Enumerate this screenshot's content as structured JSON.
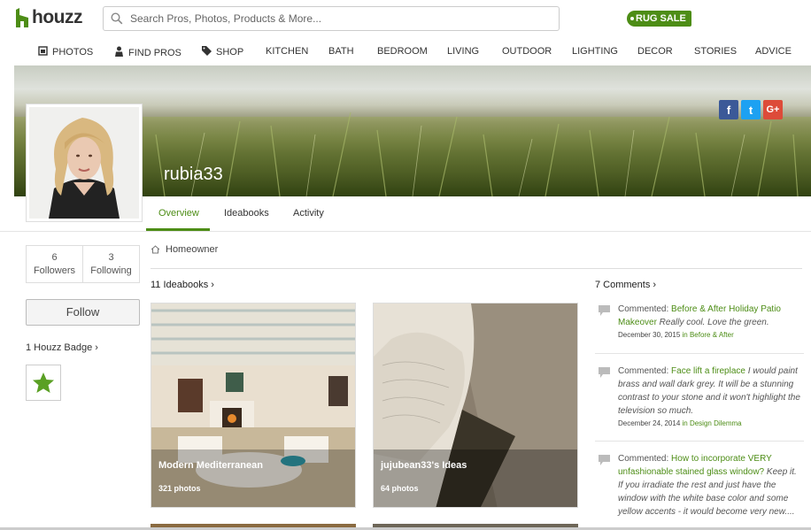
{
  "header": {
    "logo_text": "houzz",
    "search_placeholder": "Search Pros, Photos, Products & More...",
    "promo": "RUG SALE",
    "brand_color": "#4d8d16"
  },
  "nav": {
    "items": [
      {
        "label": "PHOTOS",
        "icon": "photos-icon"
      },
      {
        "label": "FIND PROS",
        "icon": "find-pros-icon"
      },
      {
        "label": "SHOP",
        "icon": "tag-icon"
      },
      {
        "label": "KITCHEN"
      },
      {
        "label": "BATH"
      },
      {
        "label": "BEDROOM"
      },
      {
        "label": "LIVING"
      },
      {
        "label": "OUTDOOR"
      },
      {
        "label": "LIGHTING"
      },
      {
        "label": "DECOR"
      },
      {
        "label": "STORIES"
      },
      {
        "label": "ADVICE"
      }
    ]
  },
  "profile": {
    "username": "rubia33",
    "role": "Homeowner",
    "social": [
      "f",
      "t",
      "G+"
    ],
    "followers_count": "6",
    "followers_label": "Followers",
    "following_count": "3",
    "following_label": "Following",
    "follow_label": "Follow",
    "badge_title": "1 Houzz Badge"
  },
  "tabs": [
    "Overview",
    "Ideabooks",
    "Activity"
  ],
  "ideabooks": {
    "title": "11 Ideabooks",
    "items": [
      {
        "title": "Modern Mediterranean",
        "count": "321 photos"
      },
      {
        "title": "jujubean33's Ideas",
        "count": "64 photos"
      }
    ]
  },
  "comments": {
    "title": "7 Comments",
    "items": [
      {
        "prefix": "Commented: ",
        "link": "Before & After Holiday Patio Makeover",
        "body": " Really cool. Love the green.",
        "date": "December 30, 2015",
        "in": " in ",
        "category": "Before & After"
      },
      {
        "prefix": "Commented: ",
        "link": "Face lift a fireplace",
        "body": " I would paint brass and wall dark grey. It will be a stunning contrast to your stone and it won't highlight the television so much.",
        "date": "December 24, 2014",
        "in": " in ",
        "category": "Design Dilemma"
      },
      {
        "prefix": "Commented: ",
        "link": "How to incorporate VERY unfashionable stained glass window?",
        "body": " Keep it. If you irradiate the rest and just have the window with the white base color and some yellow accents - it would become very new....",
        "date": "",
        "in": "",
        "category": ""
      }
    ]
  }
}
